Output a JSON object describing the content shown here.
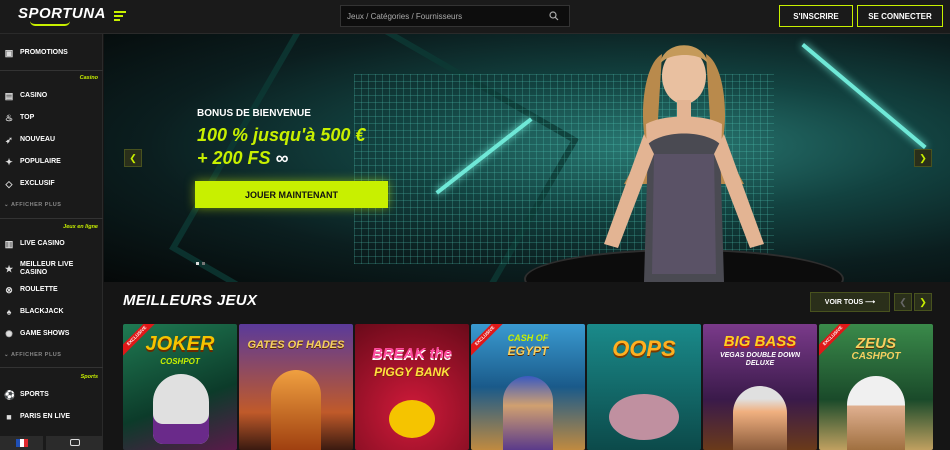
{
  "header": {
    "logo_text": "SPORTUNA",
    "search": {
      "placeholder": "Jeux / Catégories / Fournisseurs"
    },
    "register_label": "S'INSCRIRE",
    "login_label": "SE CONNECTER"
  },
  "sidebar": {
    "promotions": "PROMOTIONS",
    "casino_section": "Casino",
    "casino_items": [
      "CASINO",
      "TOP",
      "NOUVEAU",
      "POPULAIRE",
      "EXCLUSIF"
    ],
    "casino_more": "AFFICHER PLUS",
    "live_section": "Jeux en ligne",
    "live_items": [
      "LIVE CASINO",
      "MEILLEUR LIVE CASINO",
      "ROULETTE",
      "BLACKJACK",
      "GAME SHOWS"
    ],
    "live_more": "AFFICHER PLUS",
    "sports_section": "Sports",
    "sports_items": [
      "SPORTS",
      "PARIS EN LIVE"
    ],
    "language_flag": "🇫🇷"
  },
  "hero": {
    "subtitle": "BONUS DE BIENVENUE",
    "line1_pct": "100 % jusqu'à",
    "line1_amount": "500 €",
    "line2": "+ 200 FS",
    "line2_suffix": "∞",
    "cta_label": "JOUER MAINTENANT",
    "slide_count": 2,
    "active_slide": 1
  },
  "games_section": {
    "title": "MEILLEURS JEUX",
    "view_all_label": "VOIR TOUS",
    "exclusive_label": "EXCLUSIVE",
    "games": [
      {
        "title": "JOKER",
        "subtitle": "COSHPOT",
        "exclusive": true,
        "bg": "#1a6b4a"
      },
      {
        "title": "GATES OF HADES",
        "subtitle": "",
        "exclusive": false,
        "bg": "#3a1a5a"
      },
      {
        "title": "BREAK the",
        "subtitle": "PIGGY BANK",
        "exclusive": false,
        "bg": "#8a1a2a"
      },
      {
        "title": "CASH OF",
        "subtitle": "EGYPT",
        "exclusive": true,
        "bg": "#1a5a8a"
      },
      {
        "title": "OOPS",
        "subtitle": "",
        "exclusive": false,
        "bg": "#1a6a6a"
      },
      {
        "title": "BIG BASS",
        "subtitle": "VEGAS DOUBLE DOWN DELUXE",
        "exclusive": false,
        "bg": "#5a2a1a"
      },
      {
        "title": "ZEUS",
        "subtitle": "CASHPOT",
        "exclusive": true,
        "bg": "#3a6a3a"
      }
    ]
  },
  "colors": {
    "accent": "#c8f000",
    "background": "#151515",
    "panel": "#1a1a1a"
  },
  "icons": [
    "menu-icon",
    "search-icon",
    "gift-icon",
    "casino-icon",
    "flame-icon",
    "rocket-icon",
    "sparkle-icon",
    "diamond-icon",
    "cards-icon",
    "star-icon",
    "roulette-icon",
    "spade-icon",
    "wheel-icon",
    "soccer-icon",
    "camera-icon",
    "chat-icon",
    "chevron-left-icon",
    "chevron-right-icon",
    "arrow-right-icon"
  ]
}
